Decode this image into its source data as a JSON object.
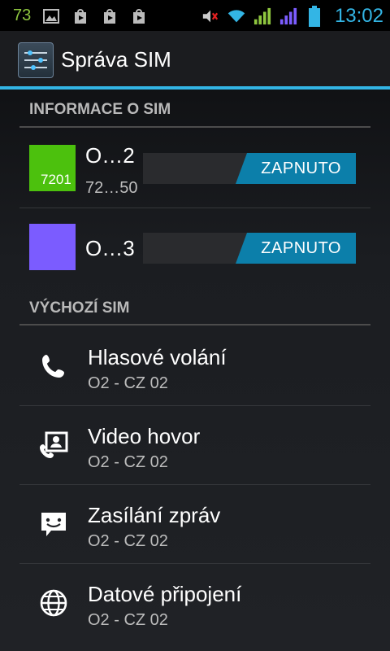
{
  "status_bar": {
    "battery_level_text": "73",
    "time": "13:02",
    "icons": [
      "image-icon",
      "play-store-icon",
      "play-store-icon",
      "play-store-icon",
      "mute-icon",
      "wifi-icon",
      "signal-green-icon",
      "signal-purple-icon",
      "battery-icon"
    ]
  },
  "action_bar": {
    "title": "Správa SIM",
    "icon": "sim-settings-icon"
  },
  "sections": {
    "sim_info": "INFORMACE O SIM",
    "default_sim": "VÝCHOZÍ SIM"
  },
  "sims": [
    {
      "name": "O…2",
      "number": "72…50",
      "color_label": "7201",
      "color": "#4cc10d",
      "toggle_label": "ZAPNUTO"
    },
    {
      "name": "O…3",
      "number": "",
      "color_label": "",
      "color": "#7b5cff",
      "toggle_label": "ZAPNUTO"
    }
  ],
  "defaults": [
    {
      "title": "Hlasové volání",
      "subtitle": "O2 - CZ 02",
      "icon": "phone-icon"
    },
    {
      "title": "Video hovor",
      "subtitle": "O2 - CZ 02",
      "icon": "video-call-icon"
    },
    {
      "title": "Zasílání zpráv",
      "subtitle": "O2 - CZ 02",
      "icon": "message-icon"
    },
    {
      "title": "Datové připojení",
      "subtitle": "O2 - CZ 02",
      "icon": "globe-icon"
    }
  ],
  "colors": {
    "accent": "#33b5e5",
    "toggle_on": "#0c7faa"
  }
}
